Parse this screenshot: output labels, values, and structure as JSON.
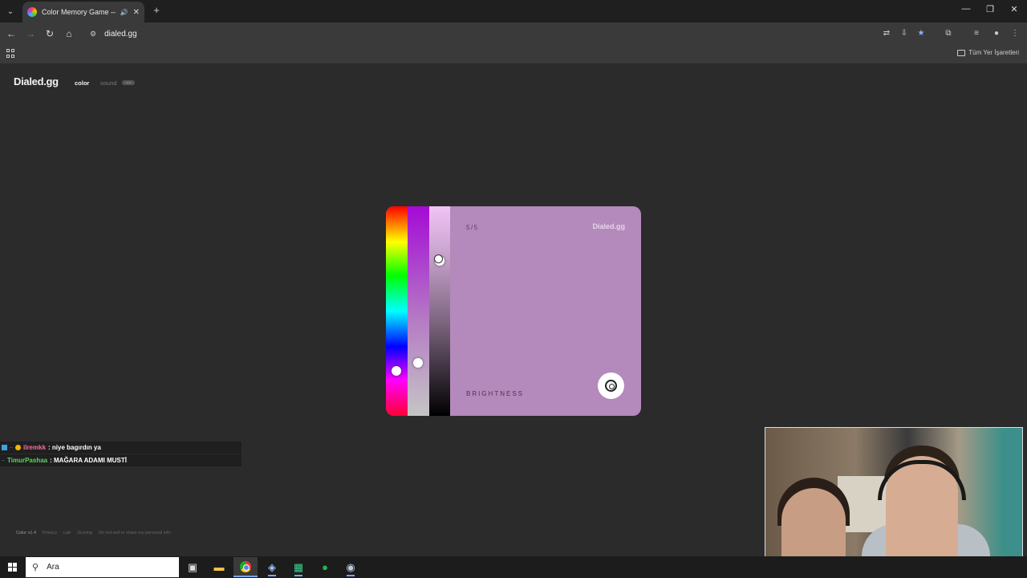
{
  "browser": {
    "tab_title": "Color Memory Game — Ho",
    "url": "dialed.gg",
    "bookmarks_all": "Tüm Yer İşaretleri"
  },
  "site": {
    "brand": "Dialed.gg",
    "nav_color": "color",
    "nav_sound": "sound",
    "new_badge": "new"
  },
  "game": {
    "round": "5/5",
    "card_brand": "Dialed.gg",
    "mode_label": "BRIGHTNESS",
    "background_color": "#b489bb",
    "hue_level": 0.8,
    "saturation_level": 0.76,
    "brightness_level": 0.25
  },
  "chat": [
    {
      "user": "ilremkk",
      "message": ": niye bagırdın ya",
      "user_color": "#ff6ba3"
    },
    {
      "user": "TimurPashaa",
      "message": ": MAĞARA ADAMI MUSTİ",
      "user_color": "#5bd65b"
    }
  ],
  "footer": {
    "version": "Color v1.4",
    "links": [
      "Privacy",
      "Lab",
      "Scoring",
      "Do not sell or share my personal info"
    ]
  },
  "taskbar": {
    "search_placeholder": "Ara"
  }
}
